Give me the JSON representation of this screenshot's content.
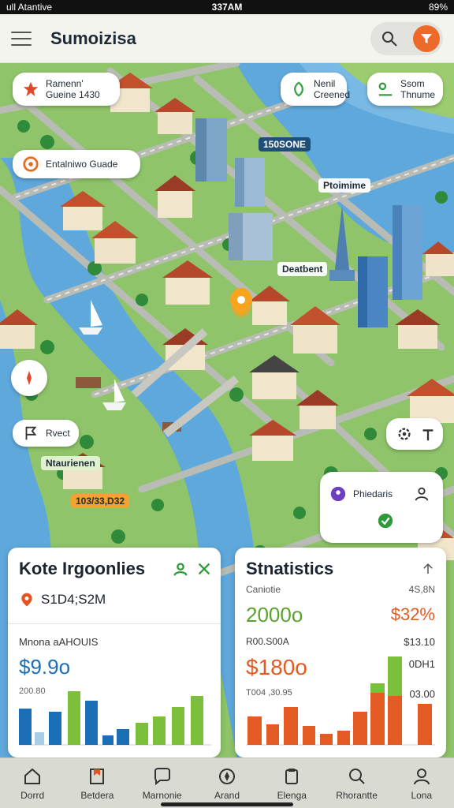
{
  "status_bar": {
    "carrier": "ull Atantive",
    "time": "337AM",
    "battery": "89%"
  },
  "header": {
    "title": "Sumoizisa",
    "search_icon": "search-icon",
    "filter_icon": "filter-icon",
    "accent": "#ec6a2a"
  },
  "map": {
    "chips": {
      "top_left": {
        "line1": "Ramenn'",
        "line2": "Gueine 1430"
      },
      "left_mid": {
        "line1": "Entalniwo Guade"
      },
      "top_right_1": {
        "line1": "Nenil",
        "line2": "Creened"
      },
      "top_right_2": {
        "line1": "Ssom",
        "line2": "Thnume"
      },
      "left_lower": {
        "line1": "Rvect"
      },
      "right_lower": {
        "line1": "Phiedaris"
      }
    },
    "tags": {
      "city": "150SONE",
      "poi": "Ptoimime",
      "district": "Deatbent",
      "green": "Ntaurienen",
      "orange": "103/33,D32"
    }
  },
  "card_left": {
    "title": "Kote Irgoonlies",
    "summary": "S1D4;S2M",
    "sub_label": "Mnona aAHOUIS",
    "big_value": "$9.9o",
    "axis_label": "200.80",
    "colors": {
      "blue": "#1b6fb6",
      "green": "#7bbf3a"
    }
  },
  "card_right": {
    "title": "Stnatistics",
    "label_left": "Caniotie",
    "label_right": "4S,8N",
    "big_left": "2000o",
    "big_right": "$32%",
    "label_left_2": "R00.S00A",
    "label_right_2": "$13.10",
    "big_left_2": "$180o",
    "label_right_3": "0DH1",
    "label_left_3": "T004 ,30.95",
    "label_right_4": "03.00",
    "colors": {
      "orange": "#e35b22",
      "green": "#7bbf3a"
    }
  },
  "nav": {
    "items": [
      {
        "label": "Dorrd",
        "icon": "home-icon"
      },
      {
        "label": "Betdera",
        "icon": "bookmark-icon"
      },
      {
        "label": "Marnonie",
        "icon": "chat-icon"
      },
      {
        "label": "Arand",
        "icon": "compass-icon"
      },
      {
        "label": "Elenga",
        "icon": "clipboard-icon"
      },
      {
        "label": "Rhorantte",
        "icon": "search-icon"
      },
      {
        "label": "Lona",
        "icon": "profile-icon"
      }
    ]
  }
}
